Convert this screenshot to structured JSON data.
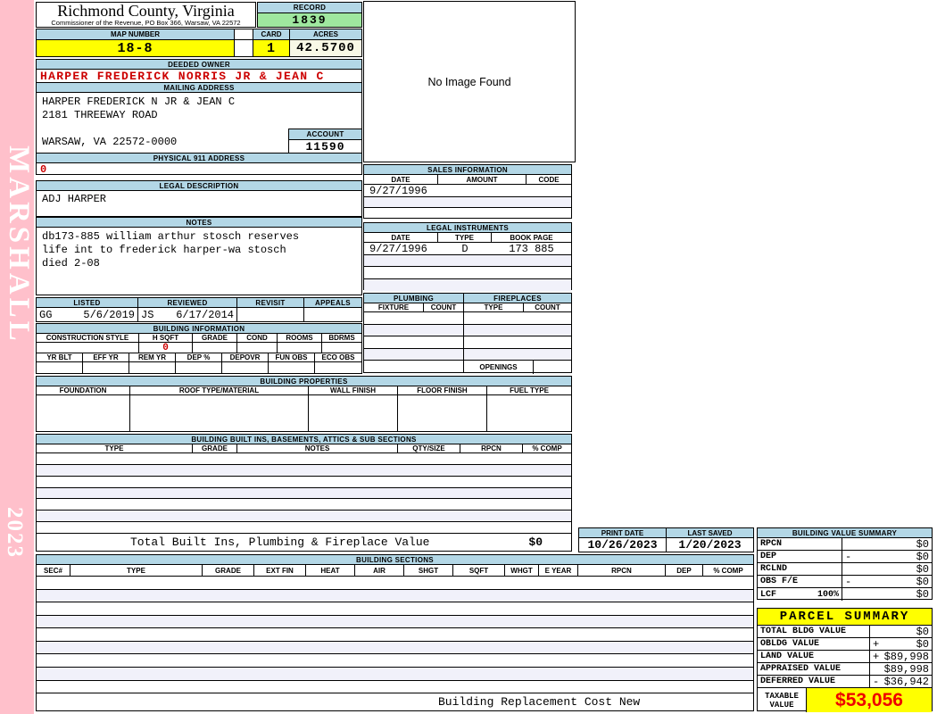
{
  "colors": {
    "header_blue": "#b3d7e6",
    "highlight_yellow": "#ffff00",
    "record_green": "#9fe79f",
    "acres_cream": "#f8f8e6",
    "sidebar_pink": "#ffc0cb",
    "alert_red": "#cc0000",
    "taxable_red": "#ee0000",
    "alt_row": "#f1f1fa"
  },
  "sidebar": {
    "vendor": "MARSHALL",
    "year": "2023"
  },
  "header": {
    "county": "Richmond County, Virginia",
    "commissioner_line": "Commissioner of the Revenue, PO Box 366, Warsaw, VA 22572",
    "record_label": "RECORD",
    "record_value": "1839",
    "map_number_label": "MAP NUMBER",
    "map_number_value": "18-8",
    "card_label": "CARD",
    "card_value": "1",
    "acres_label": "ACRES",
    "acres_value": "42.5700"
  },
  "owner": {
    "deeded_owner_label": "DEEDED OWNER",
    "deeded_owner": "HARPER FREDERICK NORRIS JR & JEAN C",
    "mailing_address_label": "MAILING ADDRESS",
    "mailing_lines": [
      "HARPER FREDERICK N JR & JEAN C",
      "2181 THREEWAY ROAD",
      "",
      "WARSAW, VA 22572-0000"
    ],
    "account_label": "ACCOUNT",
    "account_value": "11590",
    "physical_address_label": "PHYSICAL 911 ADDRESS",
    "physical_address_value": "0"
  },
  "legal_description": {
    "label": "LEGAL DESCRIPTION",
    "value": "ADJ HARPER"
  },
  "notes": {
    "label": "NOTES",
    "lines": [
      "db173-885 william arthur stosch reserves",
      "life int to frederick harper-wa stosch",
      "died 2-08"
    ]
  },
  "review": {
    "columns": [
      "LISTED",
      "REVIEWED",
      "REVISIT",
      "APPEALS"
    ],
    "listed_by": "GG",
    "listed_date": "5/6/2019",
    "reviewed_by": "JS",
    "reviewed_date": "6/17/2014",
    "revisit": "",
    "appeals": ""
  },
  "building_information": {
    "label": "BUILDING INFORMATION",
    "columns_row1": [
      "CONSTRUCTION STYLE",
      "H SQFT",
      "GRADE",
      "COND",
      "ROOMS",
      "BDRMS"
    ],
    "h_sqft_value": "0",
    "columns_row2": [
      "YR BLT",
      "EFF YR",
      "REM YR",
      "DEP %",
      "DEPOVR",
      "FUN OBS",
      "ECO OBS"
    ]
  },
  "building_properties": {
    "label": "BUILDING PROPERTIES",
    "columns": [
      "FOUNDATION",
      "ROOF TYPE/MATERIAL",
      "WALL FINISH",
      "FLOOR FINISH",
      "FUEL TYPE"
    ]
  },
  "built_ins": {
    "label": "BUILDING BUILT INS, BASEMENTS, ATTICS & SUB SECTIONS",
    "columns": [
      "TYPE",
      "GRADE",
      "NOTES",
      "QTY/SIZE",
      "RPCN",
      "% COMP"
    ],
    "total_label": "Total Built Ins, Plumbing & Fireplace Value",
    "total_value": "$0"
  },
  "image_box": {
    "text": "No Image Found"
  },
  "sales_information": {
    "label": "SALES INFORMATION",
    "columns": [
      "DATE",
      "AMOUNT",
      "CODE"
    ],
    "rows": [
      [
        "9/27/1996",
        "",
        ""
      ]
    ]
  },
  "legal_instruments": {
    "label": "LEGAL INSTRUMENTS",
    "columns": [
      "DATE",
      "TYPE",
      "BOOK PAGE"
    ],
    "rows": [
      [
        "9/27/1996",
        "D",
        "173 885"
      ]
    ]
  },
  "plumbing": {
    "label": "PLUMBING",
    "columns": [
      "FIXTURE",
      "COUNT"
    ]
  },
  "fireplaces": {
    "label": "FIREPLACES",
    "columns": [
      "TYPE",
      "COUNT"
    ],
    "openings_label": "OPENINGS"
  },
  "print_info": {
    "print_date_label": "PRINT DATE",
    "print_date": "10/26/2023",
    "last_saved_label": "LAST SAVED",
    "last_saved": "1/20/2023"
  },
  "building_value_summary": {
    "label": "BUILDING VALUE SUMMARY",
    "rows": [
      {
        "label": "RPCN",
        "extra": "",
        "op": "",
        "value": "$0"
      },
      {
        "label": "DEP",
        "extra": "",
        "op": "-",
        "value": "$0"
      },
      {
        "label": "RCLND",
        "extra": "",
        "op": "",
        "value": "$0"
      },
      {
        "label": "OBS F/E",
        "extra": "",
        "op": "-",
        "value": "$0"
      },
      {
        "label": "LCF",
        "extra": "100%",
        "op": "",
        "value": "$0"
      }
    ]
  },
  "building_sections": {
    "label": "BUILDING SECTIONS",
    "columns": [
      "SEC#",
      "TYPE",
      "GRADE",
      "EXT FIN",
      "HEAT",
      "AIR",
      "SHGT",
      "SQFT",
      "WHGT",
      "E YEAR",
      "RPCN",
      "DEP",
      "% COMP"
    ],
    "footer": "Building Replacement Cost New"
  },
  "parcel_summary": {
    "label": "PARCEL SUMMARY",
    "rows": [
      {
        "label": "TOTAL BLDG VALUE",
        "op": "",
        "value": "$0"
      },
      {
        "label": "OBLDG VALUE",
        "op": "+",
        "value": "$0"
      },
      {
        "label": "LAND VALUE",
        "op": "+",
        "value": "$89,998"
      },
      {
        "label": "APPRAISED VALUE",
        "op": "",
        "value": "$89,998"
      },
      {
        "label": "DEFERRED VALUE",
        "op": "-",
        "value": "$36,942"
      }
    ],
    "taxable_label_line1": "TAXABLE",
    "taxable_label_line2": "VALUE",
    "taxable_value": "$53,056"
  }
}
